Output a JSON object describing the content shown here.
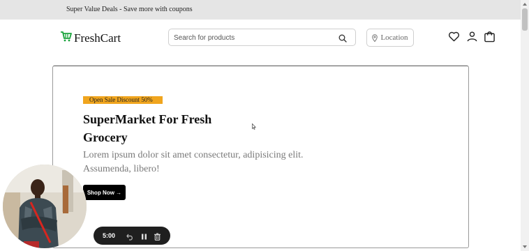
{
  "topbar": {
    "promo_text": "Super Value Deals - Save more with coupons"
  },
  "brand": {
    "name": "FreshCart",
    "accent_color": "#1aa33c"
  },
  "search": {
    "placeholder": "Search for products"
  },
  "location": {
    "label": "Location"
  },
  "header_icons": [
    "heart-icon",
    "user-icon",
    "shopping-bag-icon"
  ],
  "hero": {
    "badge": "Open Sale Discount 50%",
    "title": "SuperMarket For Fresh Grocery",
    "description": "Lorem ipsum dolor sit amet consectetur, adipisicing elit. Assumenda, libero!",
    "cta_label": "Shop Now →",
    "badge_color": "#f0a51e"
  },
  "recorder": {
    "time": "5:00",
    "controls": [
      "undo-icon",
      "pause-icon",
      "trash-icon"
    ]
  }
}
